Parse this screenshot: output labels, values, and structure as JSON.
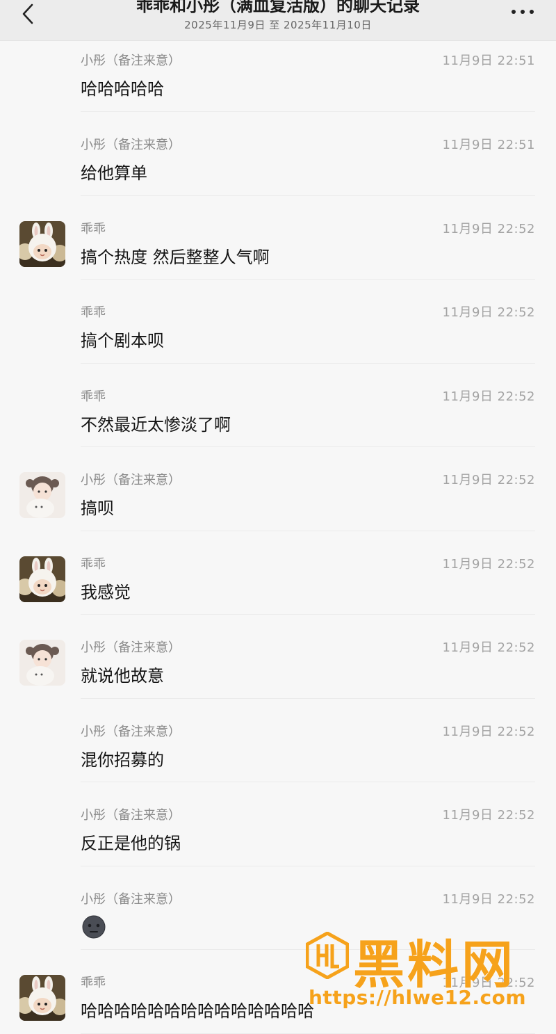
{
  "header": {
    "title": "乖乖和小彤（满血复活版）的聊天记录",
    "subtitle": "2025年11月9日 至 2025年11月10日"
  },
  "messages": [
    {
      "sender": "小彤（备注来意）",
      "time": "11月9日 22:51",
      "text": "哈哈哈哈哈",
      "avatar": ""
    },
    {
      "sender": "小彤（备注来意）",
      "time": "11月9日 22:51",
      "text": "给他算单",
      "avatar": ""
    },
    {
      "sender": "乖乖",
      "time": "11月9日 22:52",
      "text": "搞个热度 然后整整人气啊",
      "avatar": "bunny-avatar"
    },
    {
      "sender": "乖乖",
      "time": "11月9日 22:52",
      "text": "搞个剧本呗",
      "avatar": ""
    },
    {
      "sender": "乖乖",
      "time": "11月9日 22:52",
      "text": "不然最近太惨淡了啊",
      "avatar": ""
    },
    {
      "sender": "小彤（备注来意）",
      "time": "11月9日 22:52",
      "text": "搞呗",
      "avatar": "girl-avatar"
    },
    {
      "sender": "乖乖",
      "time": "11月9日 22:52",
      "text": "我感觉",
      "avatar": "bunny-avatar"
    },
    {
      "sender": "小彤（备注来意）",
      "time": "11月9日 22:52",
      "text": "就说他故意",
      "avatar": "girl-avatar"
    },
    {
      "sender": "小彤（备注来意）",
      "time": "11月9日 22:52",
      "text": "混你招募的",
      "avatar": ""
    },
    {
      "sender": "小彤（备注来意）",
      "time": "11月9日 22:52",
      "text": "反正是他的锅",
      "avatar": ""
    },
    {
      "sender": "小彤（备注来意）",
      "time": "11月9日 22:52",
      "text": "",
      "avatar": "",
      "emoji": "dark-face-emoji"
    },
    {
      "sender": "乖乖",
      "time": "11月9日 22:52",
      "text": "哈哈哈哈哈哈哈哈哈哈哈哈哈哈",
      "avatar": "bunny-avatar"
    }
  ],
  "watermark": {
    "name": "黑料网",
    "url": "https://hlwe12.com"
  },
  "colors": {
    "background": "#f7f7f7",
    "header": "#ececec",
    "watermark": "#f6a21b"
  }
}
